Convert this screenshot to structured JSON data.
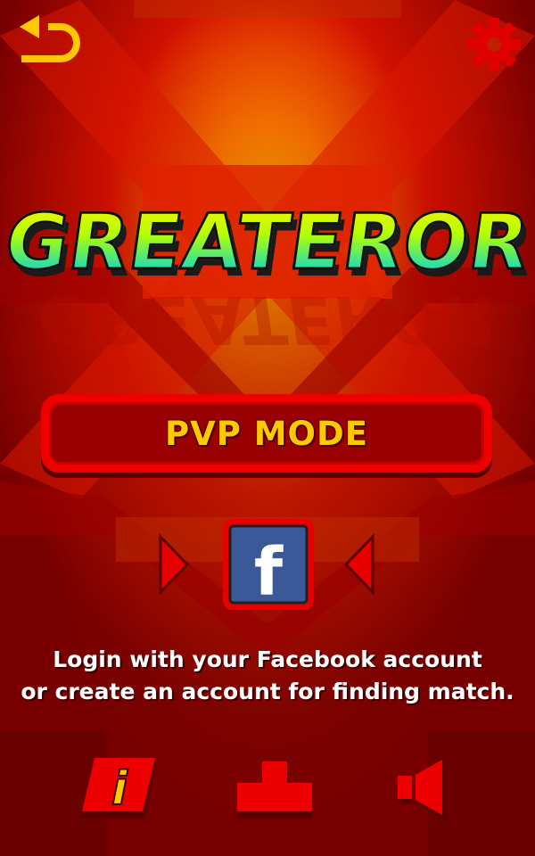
{
  "game": {
    "logo_text": "GREATEROR",
    "mode_button_label": "PVP MODE",
    "login_message_line1": "Login with your Facebook account",
    "login_message_line2": "or create an account for finding match.",
    "facebook_glyph": "f"
  },
  "icons": {
    "back": "back-arrow-icon",
    "settings": "gear-icon",
    "facebook": "facebook-icon",
    "prev": "triangle-right-icon",
    "next": "triangle-left-icon",
    "info": "info-icon",
    "leaderboard": "podium-icon",
    "sound": "speaker-icon"
  },
  "colors": {
    "accent_yellow": "#ffc800",
    "button_red": "#ee0000",
    "bg_dark_red": "#7a0000",
    "facebook_blue": "#3b5998"
  }
}
